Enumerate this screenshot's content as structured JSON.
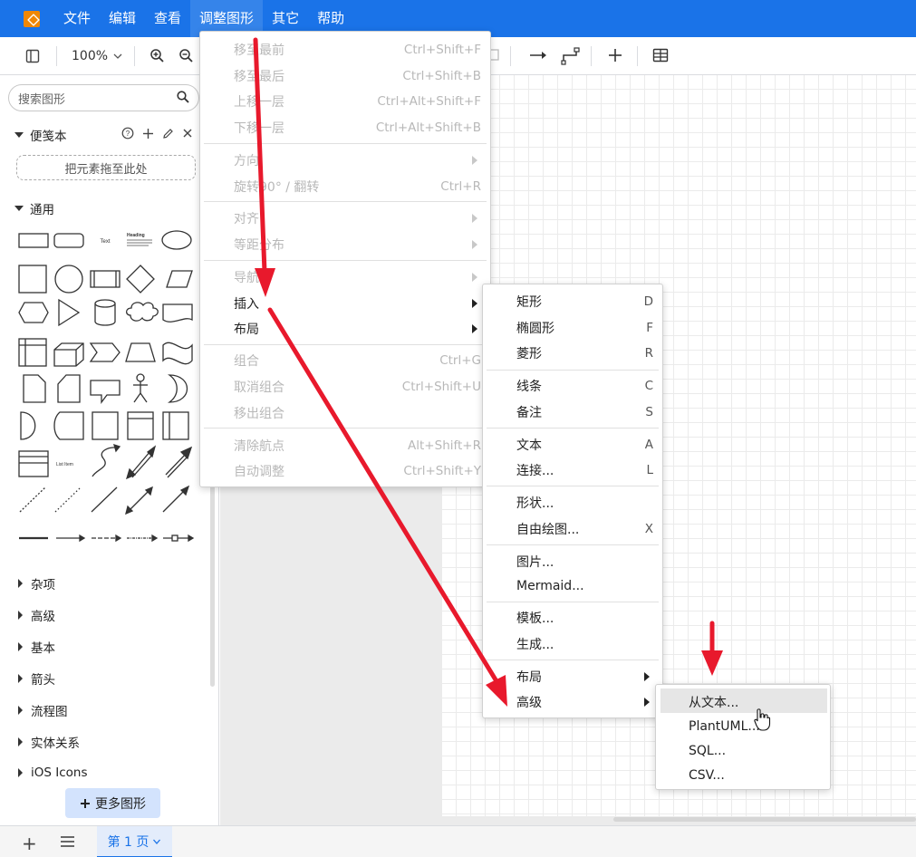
{
  "menubar": {
    "items": [
      "文件",
      "编辑",
      "查看",
      "调整图形",
      "其它",
      "帮助"
    ],
    "active_index": 3
  },
  "toolbar": {
    "zoom": "100%"
  },
  "sidebar": {
    "search_placeholder": "搜索图形",
    "scratchpad": {
      "title": "便笺本",
      "drop_hint": "把元素拖至此处"
    },
    "general": {
      "title": "通用"
    },
    "shape_texts": {
      "text": "Text",
      "heading": "Heading",
      "list_item": "List Item"
    },
    "categories": [
      "杂项",
      "高级",
      "基本",
      "箭头",
      "流程图",
      "实体关系",
      "iOS Icons"
    ],
    "more_shapes": "更多图形"
  },
  "bottom": {
    "page_tab": "第 1 页"
  },
  "menu_arrange": [
    {
      "label": "移至最前",
      "shortcut": "Ctrl+Shift+F",
      "disabled": true
    },
    {
      "label": "移至最后",
      "shortcut": "Ctrl+Shift+B",
      "disabled": true
    },
    {
      "label": "上移一层",
      "shortcut": "Ctrl+Alt+Shift+F",
      "disabled": true
    },
    {
      "label": "下移一层",
      "shortcut": "Ctrl+Alt+Shift+B",
      "disabled": true
    },
    {
      "label": "方向",
      "shortcut": "",
      "disabled": true,
      "submenu": true
    },
    {
      "label": "旋转90° / 翻转",
      "shortcut": "Ctrl+R",
      "disabled": true
    },
    {
      "label": "对齐",
      "shortcut": "",
      "disabled": true,
      "submenu": true
    },
    {
      "label": "等距分布",
      "shortcut": "",
      "disabled": true,
      "submenu": true
    },
    {
      "label": "导航",
      "shortcut": "",
      "disabled": true,
      "submenu": true
    },
    {
      "label": "插入",
      "shortcut": "",
      "disabled": false,
      "submenu": true
    },
    {
      "label": "布局",
      "shortcut": "",
      "disabled": false,
      "submenu": true
    },
    {
      "label": "组合",
      "shortcut": "Ctrl+G",
      "disabled": true
    },
    {
      "label": "取消组合",
      "shortcut": "Ctrl+Shift+U",
      "disabled": true
    },
    {
      "label": "移出组合",
      "shortcut": "",
      "disabled": true
    },
    {
      "label": "清除航点",
      "shortcut": "Alt+Shift+R",
      "disabled": true
    },
    {
      "label": "自动调整",
      "shortcut": "Ctrl+Shift+Y",
      "disabled": true
    }
  ],
  "menu_insert": [
    {
      "label": "矩形",
      "shortcut": "D"
    },
    {
      "label": "椭圆形",
      "shortcut": "F"
    },
    {
      "label": "菱形",
      "shortcut": "R"
    },
    {
      "label": "线条",
      "shortcut": "C"
    },
    {
      "label": "备注",
      "shortcut": "S"
    },
    {
      "label": "文本",
      "shortcut": "A"
    },
    {
      "label": "连接...",
      "shortcut": "L"
    },
    {
      "label": "形状...",
      "shortcut": ""
    },
    {
      "label": "自由绘图...",
      "shortcut": "X"
    },
    {
      "label": "图片...",
      "shortcut": ""
    },
    {
      "label": "Mermaid...",
      "shortcut": ""
    },
    {
      "label": "模板...",
      "shortcut": ""
    },
    {
      "label": "生成...",
      "shortcut": ""
    },
    {
      "label": "布局",
      "shortcut": "",
      "submenu": true
    },
    {
      "label": "高级",
      "shortcut": "",
      "submenu": true
    }
  ],
  "menu_advanced": [
    "从文本...",
    "PlantUML...",
    "SQL...",
    "CSV..."
  ],
  "colors": {
    "accent": "#1a73e8",
    "annotation": "#e8192c"
  }
}
